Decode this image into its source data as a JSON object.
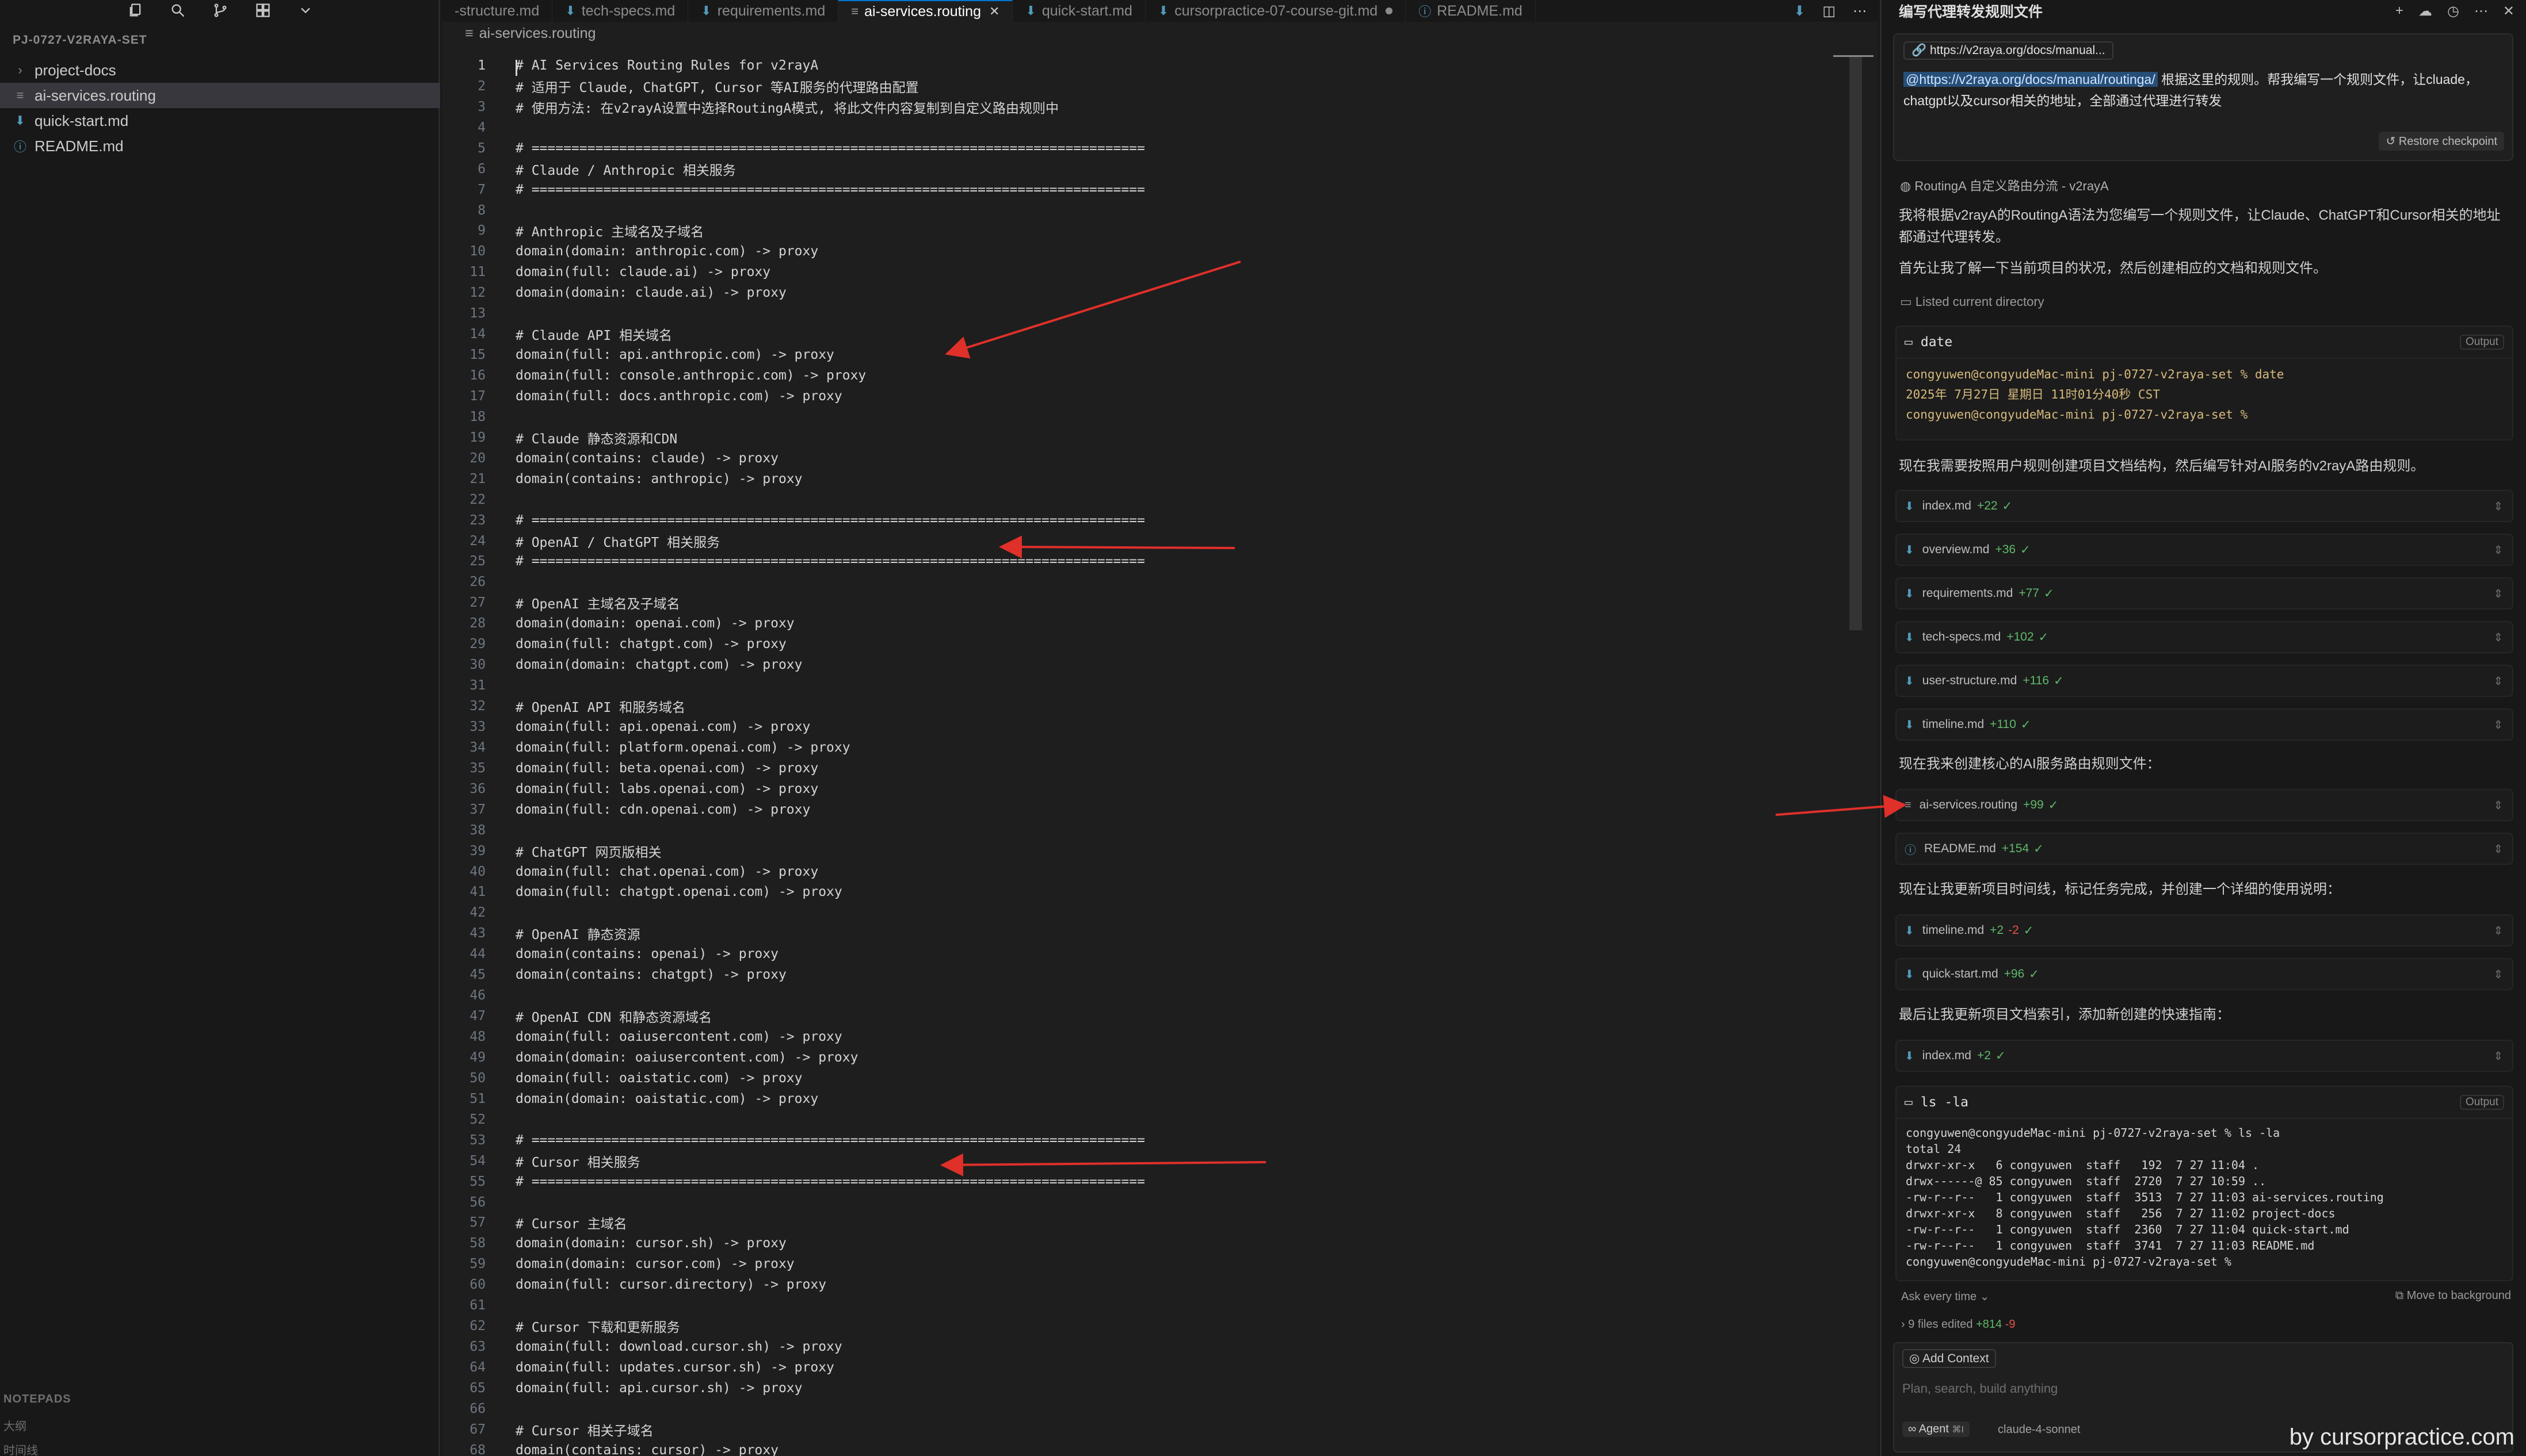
{
  "sidebar": {
    "title": "PJ-0727-V2RAYA-SET",
    "items": [
      {
        "label": "project-docs",
        "icon": "›"
      },
      {
        "label": "ai-services.routing",
        "icon": "≡"
      },
      {
        "label": "quick-start.md",
        "icon": "⬇"
      },
      {
        "label": "README.md",
        "icon": "ⓘ"
      }
    ],
    "notepads": "NOTEPADS",
    "outline": "大纲",
    "timeline": "时间线"
  },
  "tabs": [
    {
      "label": "-structure.md"
    },
    {
      "label": "tech-specs.md"
    },
    {
      "label": "requirements.md"
    },
    {
      "label": "ai-services.routing"
    },
    {
      "label": "quick-start.md"
    },
    {
      "label": "cursorpractice-07-course-git.md"
    },
    {
      "label": "README.md"
    }
  ],
  "breadcrumb": "ai-services.routing",
  "code_lines": [
    "# AI Services Routing Rules for v2rayA",
    "# 适用于 Claude, ChatGPT, Cursor 等AI服务的代理路由配置",
    "# 使用方法: 在v2rayA设置中选择RoutingA模式, 将此文件内容复制到自定义路由规则中",
    "",
    "# =============================================================================",
    "# Claude / Anthropic 相关服务",
    "# =============================================================================",
    "",
    "# Anthropic 主域名及子域名",
    "domain(domain: anthropic.com) -> proxy",
    "domain(full: claude.ai) -> proxy",
    "domain(domain: claude.ai) -> proxy",
    "",
    "# Claude API 相关域名",
    "domain(full: api.anthropic.com) -> proxy",
    "domain(full: console.anthropic.com) -> proxy",
    "domain(full: docs.anthropic.com) -> proxy",
    "",
    "# Claude 静态资源和CDN",
    "domain(contains: claude) -> proxy",
    "domain(contains: anthropic) -> proxy",
    "",
    "# =============================================================================",
    "# OpenAI / ChatGPT 相关服务",
    "# =============================================================================",
    "",
    "# OpenAI 主域名及子域名",
    "domain(domain: openai.com) -> proxy",
    "domain(full: chatgpt.com) -> proxy",
    "domain(domain: chatgpt.com) -> proxy",
    "",
    "# OpenAI API 和服务域名",
    "domain(full: api.openai.com) -> proxy",
    "domain(full: platform.openai.com) -> proxy",
    "domain(full: beta.openai.com) -> proxy",
    "domain(full: labs.openai.com) -> proxy",
    "domain(full: cdn.openai.com) -> proxy",
    "",
    "# ChatGPT 网页版相关",
    "domain(full: chat.openai.com) -> proxy",
    "domain(full: chatgpt.openai.com) -> proxy",
    "",
    "# OpenAI 静态资源",
    "domain(contains: openai) -> proxy",
    "domain(contains: chatgpt) -> proxy",
    "",
    "# OpenAI CDN 和静态资源域名",
    "domain(full: oaiusercontent.com) -> proxy",
    "domain(domain: oaiusercontent.com) -> proxy",
    "domain(full: oaistatic.com) -> proxy",
    "domain(domain: oaistatic.com) -> proxy",
    "",
    "# =============================================================================",
    "# Cursor 相关服务",
    "# =============================================================================",
    "",
    "# Cursor 主域名",
    "domain(domain: cursor.sh) -> proxy",
    "domain(domain: cursor.com) -> proxy",
    "domain(full: cursor.directory) -> proxy",
    "",
    "# Cursor 下载和更新服务",
    "domain(full: download.cursor.sh) -> proxy",
    "domain(full: updates.cursor.sh) -> proxy",
    "domain(full: api.cursor.sh) -> proxy",
    "",
    "# Cursor 相关子域名",
    "domain(contains: cursor) -> proxy"
  ],
  "panel": {
    "title": "编写代理转发规则文件",
    "url_chip": "https://v2raya.org/docs/manual...",
    "prompt_mention": "@https://v2raya.org/docs/manual/routinga/",
    "prompt_text": " 根据这里的规则。帮我编写一个规则文件，让cluade，chatgpt以及cursor相关的地址，全部通过代理进行转发",
    "restore": "Restore checkpoint",
    "source": "RoutingA 自定义路由分流 - v2rayA",
    "reply1": "我将根据v2rayA的RoutingA语法为您编写一个规则文件，让Claude、ChatGPT和Cursor相关的地址都通过代理转发。",
    "reply2": "首先让我了解一下当前项目的状况，然后创建相应的文档和规则文件。",
    "listed": "Listed current directory",
    "term1": {
      "cmd": "date",
      "output_label": "Output",
      "lines": [
        "congyuwen@congyudeMac-mini pj-0727-v2raya-set % date",
        "2025年 7月27日 星期日 11时01分40秒 CST",
        "congyuwen@congyudeMac-mini pj-0727-v2raya-set %"
      ]
    },
    "reply3": "现在我需要按照用户规则创建项目文档结构，然后编写针对AI服务的v2rayA路由规则。",
    "files1": [
      {
        "name": "index.md",
        "plus": "+22",
        "minus": ""
      },
      {
        "name": "overview.md",
        "plus": "+36",
        "minus": ""
      },
      {
        "name": "requirements.md",
        "plus": "+77",
        "minus": ""
      },
      {
        "name": "tech-specs.md",
        "plus": "+102",
        "minus": ""
      },
      {
        "name": "user-structure.md",
        "plus": "+116",
        "minus": ""
      },
      {
        "name": "timeline.md",
        "plus": "+110",
        "minus": ""
      }
    ],
    "reply4": "现在我来创建核心的AI服务路由规则文件：",
    "files2": [
      {
        "name": "ai-services.routing",
        "plus": "+99",
        "minus": ""
      },
      {
        "name": "README.md",
        "plus": "+154",
        "minus": ""
      }
    ],
    "reply5": "现在让我更新项目时间线，标记任务完成，并创建一个详细的使用说明：",
    "files3": [
      {
        "name": "timeline.md",
        "plus": "+2",
        "minus": "-2"
      },
      {
        "name": "quick-start.md",
        "plus": "+96",
        "minus": ""
      }
    ],
    "reply6": "最后让我更新项目文档索引，添加新创建的快速指南：",
    "files4": [
      {
        "name": "index.md",
        "plus": "+2",
        "minus": ""
      }
    ],
    "term2": {
      "cmd": "ls -la",
      "output_label": "Output",
      "lines": [
        "congyuwen@congyudeMac-mini pj-0727-v2raya-set % ls -la",
        "total 24",
        "drwxr-xr-x   6 congyuwen  staff   192  7 27 11:04 .",
        "drwx------@ 85 congyuwen  staff  2720  7 27 10:59 ..",
        "-rw-r--r--   1 congyuwen  staff  3513  7 27 11:03 ai-services.routing",
        "drwxr-xr-x   8 congyuwen  staff   256  7 27 11:02 project-docs",
        "-rw-r--r--   1 congyuwen  staff  2360  7 27 11:04 quick-start.md",
        "-rw-r--r--   1 congyuwen  staff  3741  7 27 11:03 README.md",
        "congyuwen@congyudeMac-mini pj-0727-v2raya-set %"
      ]
    },
    "ask_every_time": "Ask every time",
    "move_bg": "Move to background",
    "files_edited": "9 files edited",
    "files_edited_plus": "+814",
    "files_edited_minus": "-9",
    "add_context": "Add Context",
    "placeholder": "Plan, search, build anything",
    "agent": "Agent",
    "agent_shortcut": "⌘I",
    "model": "claude-4-sonnet"
  },
  "watermark": "by cursorpractice.com",
  "colors": {
    "accent": "#0078d4",
    "arrow": "#e0302a",
    "added": "#5fb86a",
    "removed": "#e5534b"
  }
}
